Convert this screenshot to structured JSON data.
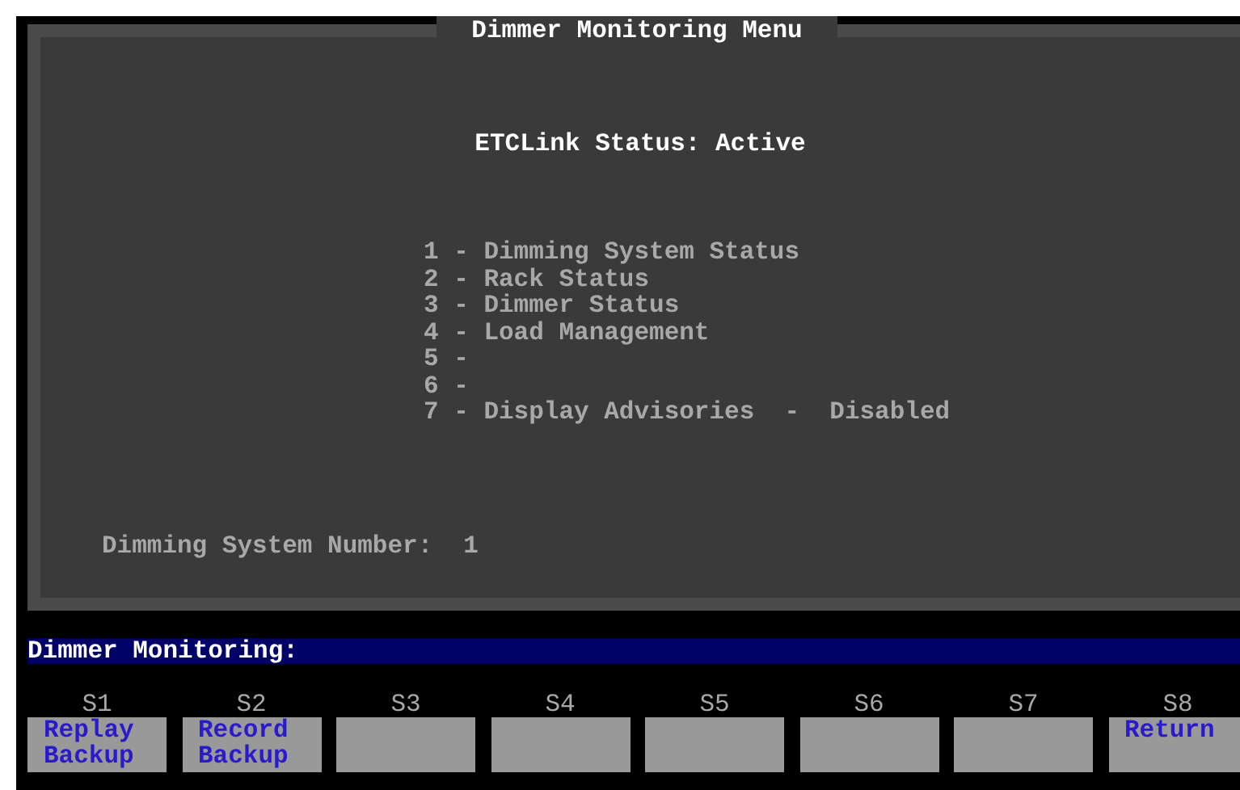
{
  "window": {
    "title": "Dimmer Monitoring Menu"
  },
  "status": "ETCLink Status: Active",
  "menu_items": [
    {
      "text": "1 - Dimming System Status"
    },
    {
      "text": "2 - Rack Status"
    },
    {
      "text": "3 - Dimmer Status"
    },
    {
      "text": "4 - Load Management"
    },
    {
      "text": "5 -"
    },
    {
      "text": "6 -"
    },
    {
      "text": "7 - Display Advisories  -  Disabled"
    }
  ],
  "dimming_system_number": {
    "label": "Dimming System Number:",
    "value": "1"
  },
  "command_line": "Dimmer Monitoring:",
  "softkeys": [
    {
      "key": "S1",
      "lines": [
        "Replay",
        "Backup"
      ]
    },
    {
      "key": "S2",
      "lines": [
        "Record",
        "Backup"
      ]
    },
    {
      "key": "S3"
    },
    {
      "key": "S4"
    },
    {
      "key": "S5"
    },
    {
      "key": "S6"
    },
    {
      "key": "S7"
    },
    {
      "key": "S8",
      "lines": [
        "Return"
      ]
    }
  ]
}
